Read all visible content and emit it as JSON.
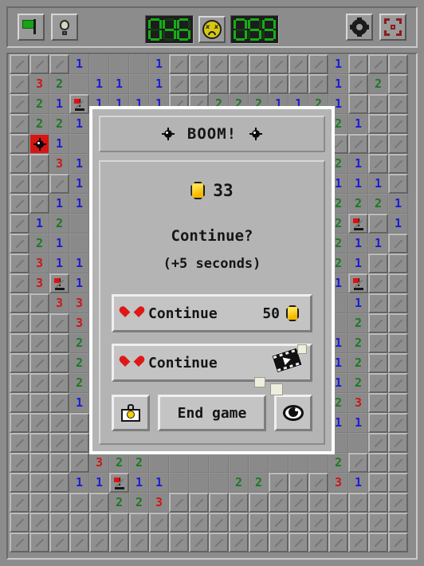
{
  "app": {
    "title": "Minesweeper",
    "background_color": "#8c8c8c"
  },
  "toolbar": {
    "flag_button": {
      "name": "flag-mode",
      "icon": "flag-icon"
    },
    "hint_button": {
      "name": "hint",
      "icon": "lightbulb-icon"
    },
    "mines_counter": "046",
    "timer_counter": "059",
    "face_button": {
      "icon": "dead-face-icon",
      "state": "dead"
    },
    "settings_button": {
      "name": "settings",
      "icon": "gear-icon"
    },
    "fullscreen_button": {
      "name": "fullscreen",
      "icon": "fullscreen-icon"
    }
  },
  "dialog": {
    "title": "BOOM!",
    "title_icon_left": "mine-icon",
    "title_icon_right": "mine-icon",
    "coin_balance": "33",
    "coin_icon": "coin-icon",
    "prompt": "Continue?",
    "prompt_sub": "(+5 seconds)",
    "continue_coins": {
      "label": "Continue",
      "cost": "50",
      "heart_icon": "heart-icon",
      "coin_icon": "coin-icon"
    },
    "continue_ad": {
      "label": "Continue",
      "heart_icon": "heart-icon",
      "ad_icon": "video-ad-icon"
    },
    "shop_button": {
      "icon": "shop-bag-coin-icon"
    },
    "end_game_button": {
      "label": "End game"
    },
    "watch_button": {
      "icon": "eye-icon"
    }
  },
  "colors": {
    "n1": "#1b1bd6",
    "n2": "#1a7a22",
    "n3": "#cf1616",
    "mine_blast_bg": "#d81414",
    "coin": "#ffcc00",
    "heart": "#e01717",
    "display_on": "#16ad16",
    "display_off": "#123d12"
  },
  "grid": {
    "columns": 20,
    "rows": 25,
    "cell_size": 25,
    "legend": {
      "h": "hidden",
      "o": "empty-open",
      "F": "flag",
      "X": "exploded-mine",
      "1-8": "number"
    },
    "rows_data": [
      "hhh1ooo1hhhhhhhh1hhh",
      "h32o11o1hhhhhhhh1h2h",
      "h21F1111hh2221121hhh",
      "h221oo11h1111o1121hh",
      "hX1oooooo1hhh112hhhh",
      "hh31oooo11hooo1221hh",
      "hhh1ooooooooooo1111h",
      "hh11ooooooooooo12221",
      "h12oo1111oooooo12Fh1",
      "h21o11FF1oooooo1211h",
      "h31111221oooooo121hh",
      "h3F1oooo1ooooooo1Fhh",
      "hh331oo11oooooooo1hh",
      "hhh3F1ooooooooooo2hh",
      "hhh221ooo1111ooo12hh",
      "hhh2F1oo12FF21oo12hh",
      "hhh221oo1FF321oo12hh",
      "hhh1ooooo12221oo23hh",
      "hhhhoooooooooooo11hh",
      "hhhh31F1ooooooo2oohh",
      "hhhh322ooooooooo2hhh",
      "hhh11F11ooo22hhh31hh",
      "hhhhh223hhhhhhhhhhhh",
      "hhhhhhhhhhhhhhhhhhhh",
      "hhhhhhhhhhhhhhhhhhhh"
    ]
  }
}
